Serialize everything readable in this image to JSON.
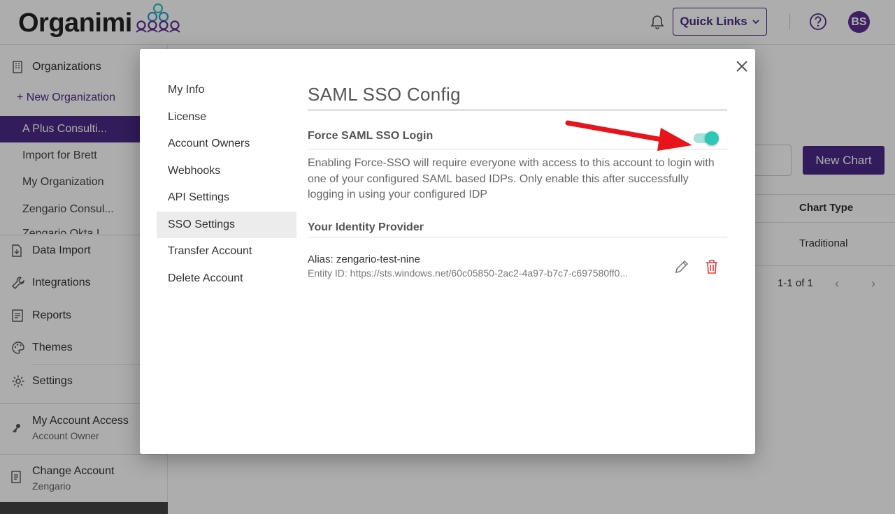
{
  "app": {
    "logo": "Organimi"
  },
  "topbar": {
    "quick_links": "Quick Links",
    "avatar": "BS"
  },
  "sidebar": {
    "organizations": "Organizations",
    "new_org": "+ New Organization",
    "orgs": [
      "A Plus Consulti...",
      "Import for Brett",
      "My Organization",
      "Zengario Consul...",
      "Zengario Okta I..."
    ],
    "nav": [
      "Data Import",
      "Integrations",
      "Reports",
      "Themes",
      "Settings"
    ],
    "account_access": {
      "title": "My Account Access",
      "subtitle": "Account Owner"
    },
    "change_account": {
      "title": "Change Account",
      "subtitle": "Zengario"
    }
  },
  "main": {
    "new_chart": "New Chart",
    "chart_type_header": "Chart Type",
    "chart_type_value": "Traditional",
    "pagination": "1-1 of 1"
  },
  "modal": {
    "menu": [
      "My Info",
      "License",
      "Account Owners",
      "Webhooks",
      "API Settings",
      "SSO Settings",
      "Transfer Account",
      "Delete Account"
    ],
    "active_menu": "SSO Settings",
    "title": "SAML SSO Config",
    "force_label": "Force SAML SSO Login",
    "force_enabled": true,
    "description": "Enabling Force-SSO will require everyone with access to this account to login with one of your configured SAML based IDPs. Only enable this after successfully logging in using your configured IDP",
    "idp_header": "Your Identity Provider",
    "idp": {
      "alias": "Alias: zengario-test-nine",
      "entity": "Entity ID: https://sts.windows.net/60c05850-2ac2-4a97-b7c7-c697580ff0..."
    }
  },
  "colors": {
    "brand": "#4b2a86",
    "toggle": "#2cc7b5",
    "danger": "#e53935",
    "arrow": "#e8141b"
  }
}
